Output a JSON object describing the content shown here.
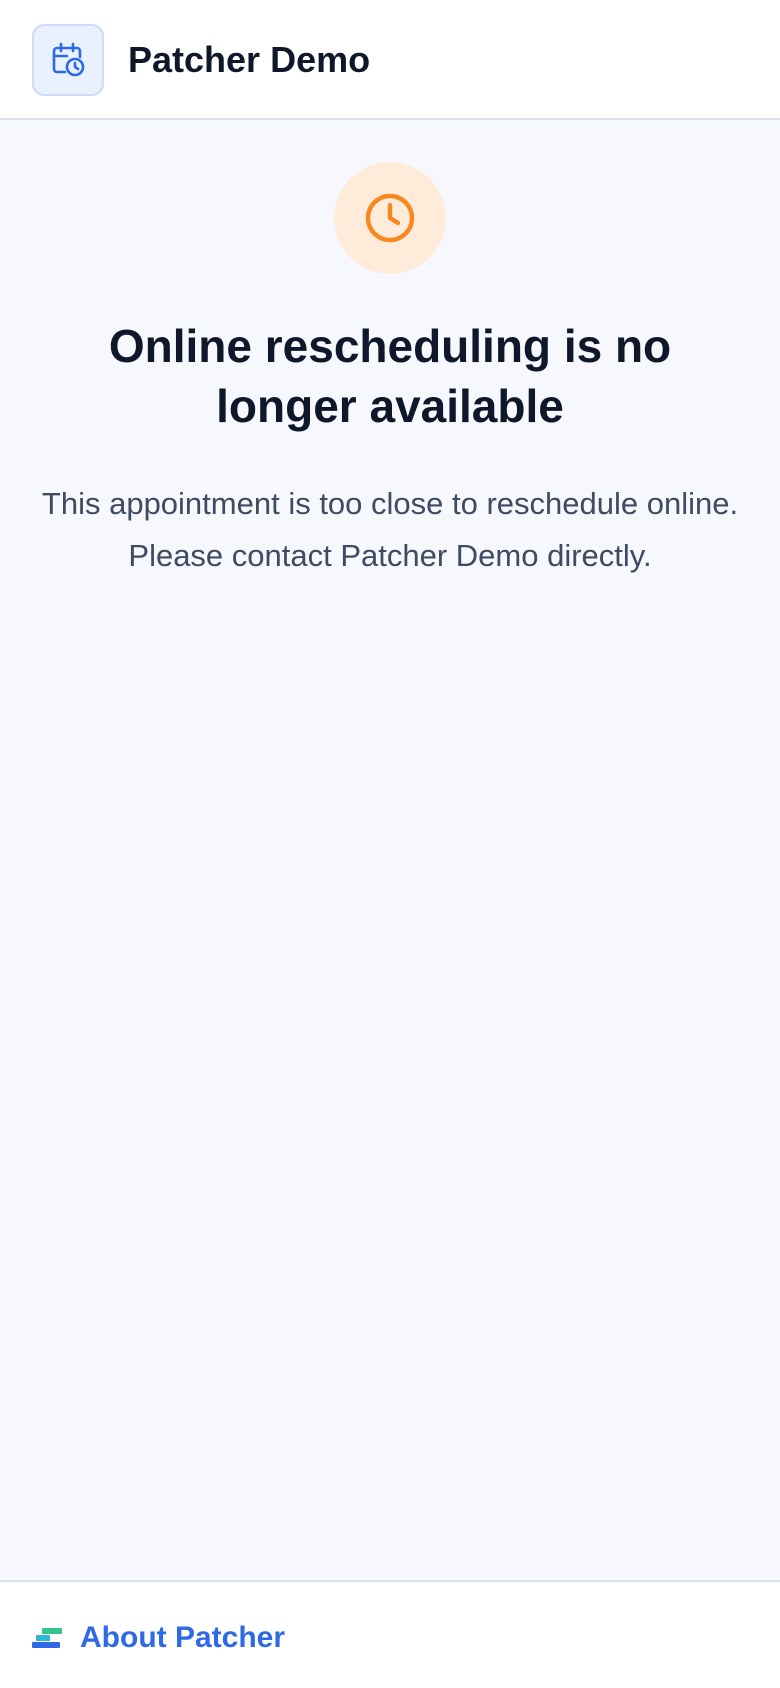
{
  "header": {
    "brand_name": "Patcher Demo",
    "logo_icon": "calendar-clock-icon"
  },
  "main": {
    "status_icon": "clock-icon",
    "title": "Online rescheduling is no longer available",
    "message": "This appointment is too close to reschedule online. Please contact Patcher Demo directly."
  },
  "footer": {
    "about_label": "About Patcher",
    "about_icon": "patcher-logo-icon"
  },
  "colors": {
    "accent": "#2F6AE6",
    "warning": "#F5891F",
    "warning_bg": "#FFEBD9",
    "page_bg": "#F6F8FD",
    "text_primary": "#0F172A",
    "text_secondary": "#3F4B63"
  }
}
